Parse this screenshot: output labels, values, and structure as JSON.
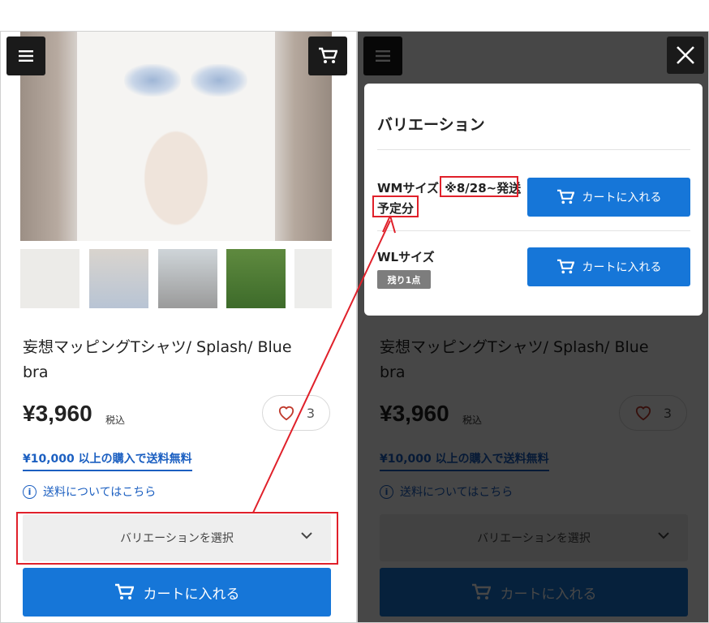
{
  "product": {
    "title_line1": "妄想マッピングTシャツ/ Splash/ Blue",
    "title_line2": "bra",
    "price": "¥3,960",
    "tax_label": "税込",
    "like_count": "3",
    "free_shipping": "¥10,000 以上の購入で送料無料",
    "shipping_info": "送料についてはこちら",
    "variation_select": "バリエーションを選択",
    "add_to_cart": "カートに入れる"
  },
  "modal": {
    "title": "バリエーション",
    "variants": [
      {
        "name": "WMサイズ",
        "note_part1": "※8/28~発送",
        "note_part2": "予定分",
        "button": "カートに入れる"
      },
      {
        "name": "WLサイズ",
        "badge": "残り1点",
        "button": "カートに入れる"
      }
    ]
  },
  "icons": {
    "menu": "hamburger-menu-icon",
    "cart": "cart-icon",
    "close": "close-icon",
    "heart": "heart-icon",
    "info": "info-icon",
    "chevron": "chevron-down-icon"
  },
  "colors": {
    "accent_blue": "#1676d8",
    "link_blue": "#1b5fc1",
    "annotation_red": "#e0202a",
    "heart_red": "#c0392b"
  }
}
